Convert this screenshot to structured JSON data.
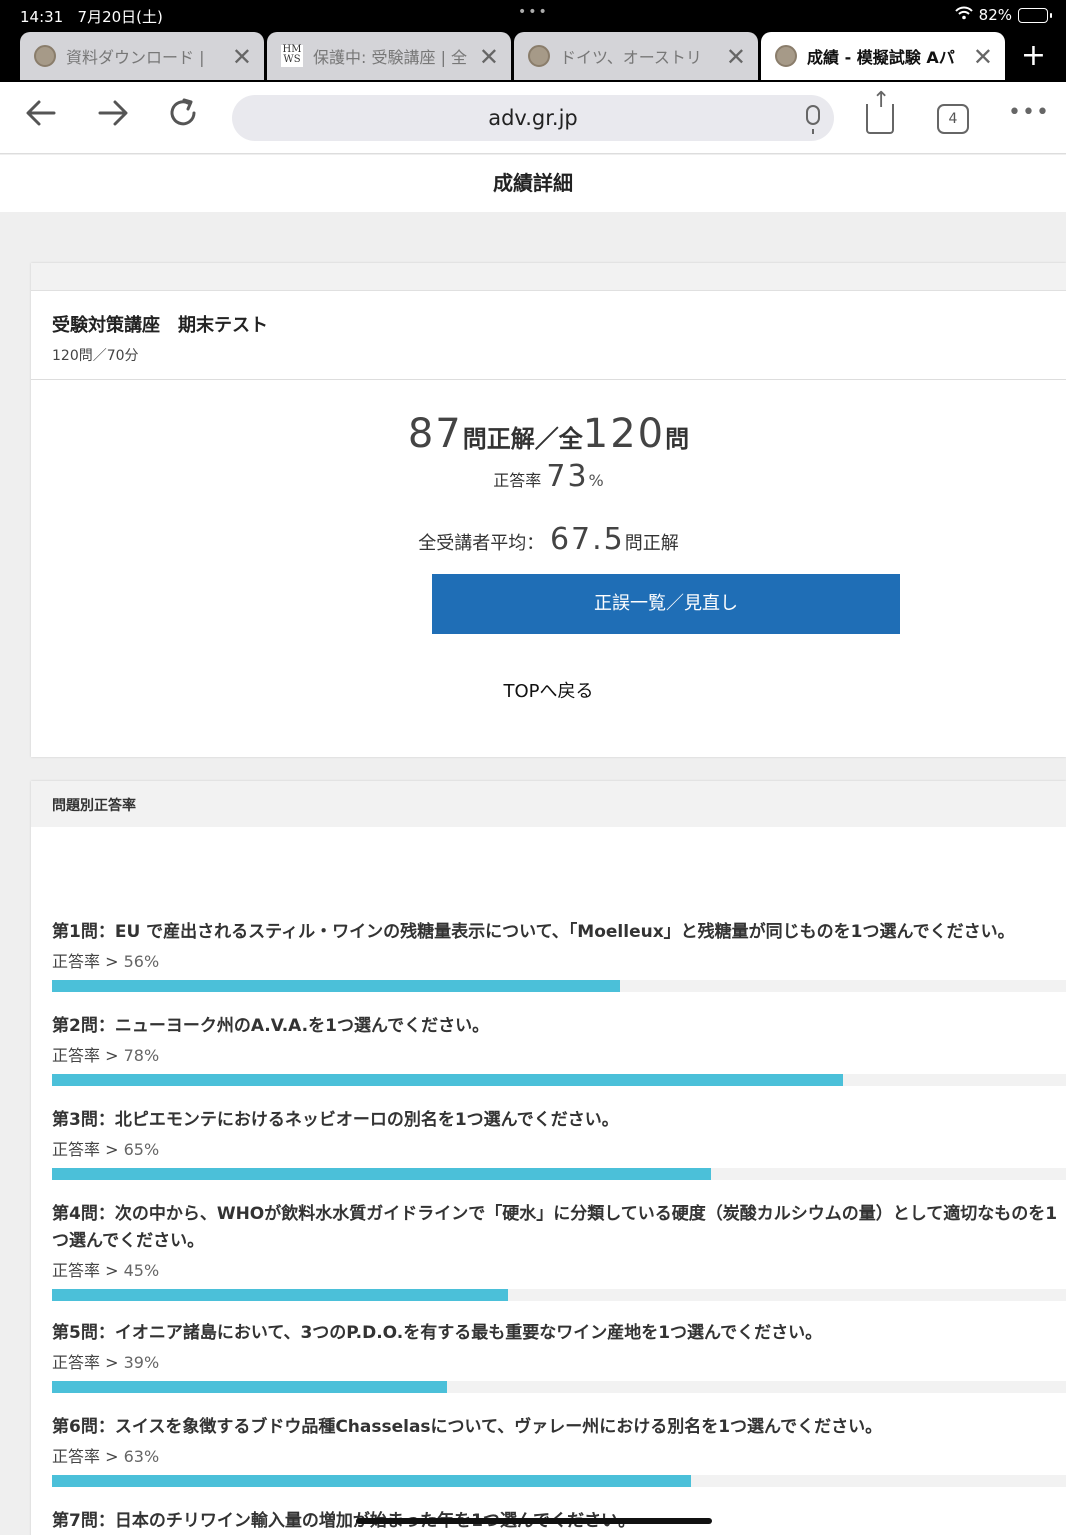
{
  "status": {
    "time": "14:31",
    "date": "7月20日(土)",
    "dots": "•••",
    "battery": "82%",
    "battery_level": 0.82
  },
  "tabs": [
    {
      "label": "資料ダウンロード | ",
      "active": false,
      "favicon": "seal-icon"
    },
    {
      "label": "保護中: 受験講座 | 全",
      "active": false,
      "favicon": "HM WS"
    },
    {
      "label": "ドイツ、オーストリ",
      "active": false,
      "favicon": "seal-icon"
    },
    {
      "label": "成績 - 模擬試験 Aパ",
      "active": true,
      "favicon": "seal-icon"
    }
  ],
  "toolbar": {
    "url": "adv.gr.jp",
    "tab_count": "4"
  },
  "page": {
    "title": "成績詳細"
  },
  "test": {
    "name": "受験対策講座　期末テスト",
    "sub": "120問／70分"
  },
  "score": {
    "correct": "87",
    "correct_suffix": "問正解／全",
    "total": "120",
    "total_suffix": "問",
    "rate_label": "正答率",
    "rate": "73",
    "rate_unit": "%",
    "avg_label": "全受講者平均：",
    "avg": "67.5",
    "avg_suffix": "問正解"
  },
  "buttons": {
    "review": "正誤一覧／見直し",
    "top": "TOPへ戻る"
  },
  "section": {
    "title": "問題別正答率"
  },
  "rate_prefix": "正答率 > ",
  "questions": [
    {
      "title": "第1問：EU で産出されるスティル・ワインの残糖量表示について、「Moelleux」と残糖量が同じものを1つ選んでください。",
      "rate": "56%",
      "value": 0.56
    },
    {
      "title": "第2問：ニューヨーク州のA.V.A.を1つ選んでください。",
      "rate": "78%",
      "value": 0.78
    },
    {
      "title": "第3問：北ピエモンテにおけるネッビオーロの別名を1つ選んでください。",
      "rate": "65%",
      "value": 0.65
    },
    {
      "title": "第4問：次の中から、WHOが飲料水水質ガイドラインで「硬水」に分類している硬度（炭酸カルシウムの量）として適切なものを1つ選んでください。",
      "rate": "45%",
      "value": 0.45
    },
    {
      "title": "第5問：イオニア諸島において、3つのP.D.O.を有する最も重要なワイン産地を1つ選んでください。",
      "rate": "39%",
      "value": 0.39
    },
    {
      "title": "第6問：スイスを象徴するブドウ品種Chasselasについて、ヴァレー州における別名を1つ選んでください。",
      "rate": "63%",
      "value": 0.63
    },
    {
      "title": "第7問：日本のチリワイン輸入量の増加が始まった年を1つ選んでください。",
      "rate": "",
      "value": 0
    }
  ]
}
